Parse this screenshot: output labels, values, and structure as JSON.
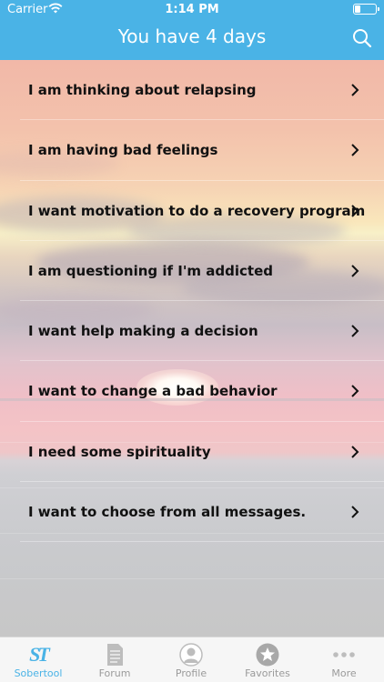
{
  "status_bar": {
    "carrier": "Carrier",
    "time": "1:14 PM"
  },
  "nav": {
    "title": "You have 4 days",
    "search_icon": "search-icon"
  },
  "menu": {
    "items": [
      {
        "label": "I am thinking about relapsing"
      },
      {
        "label": "I am having bad feelings"
      },
      {
        "label": "I want motivation to do a recovery program"
      },
      {
        "label": "I am questioning if I'm addicted"
      },
      {
        "label": "I want help making a decision"
      },
      {
        "label": "I want to change a bad behavior"
      },
      {
        "label": "I need some spirituality"
      },
      {
        "label": "I want to choose from all messages."
      }
    ]
  },
  "tabbar": {
    "tabs": [
      {
        "label": "Sobertool",
        "icon": "sobertool-logo-icon",
        "logo_text": "ST",
        "active": true
      },
      {
        "label": "Forum",
        "icon": "document-icon",
        "active": false
      },
      {
        "label": "Profile",
        "icon": "person-icon",
        "active": false
      },
      {
        "label": "Favorites",
        "icon": "star-icon",
        "active": false
      },
      {
        "label": "More",
        "icon": "more-dots-icon",
        "active": false
      }
    ]
  },
  "colors": {
    "accent": "#4ab3e6",
    "inactive": "#9a9a9a"
  }
}
